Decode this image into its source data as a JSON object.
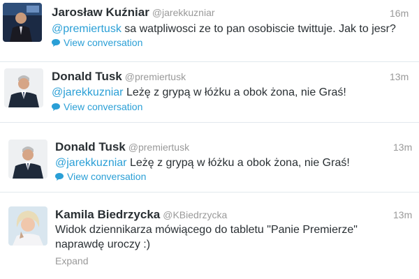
{
  "tweets": [
    {
      "name": "Jarosław Kuźniar",
      "handle": "@jarekkuzniar",
      "time": "16m",
      "mention": "@premiertusk",
      "text": " sa watpliwosci ze to pan osobiscie twittuje. Jak to jesr?",
      "action": "View conversation"
    },
    {
      "name": "Donald Tusk",
      "handle": "@premiertusk",
      "time": "13m",
      "mention": "@jarekkuzniar",
      "text": " Leżę z grypą w łóżku a obok żona, nie Graś!",
      "action": "View conversation"
    },
    {
      "name": "Donald Tusk",
      "handle": "@premiertusk",
      "time": "13m",
      "mention": "@jarekkuzniar",
      "text": " Leżę z grypą w łóżku a obok żona, nie Graś!",
      "action": "View conversation"
    },
    {
      "name": "Kamila Biedrzycka",
      "handle": "@KBiedrzycka",
      "time": "13m",
      "text_line1": "Widok dziennikarza mówiącego do tabletu \"Panie Premierze\"",
      "text_line2": "naprawdę uroczy :)",
      "action": "Expand"
    }
  ],
  "colors": {
    "link": "#2a9fd6",
    "muted": "#999999",
    "text": "#292f33",
    "divider": "#e1e8ed"
  }
}
